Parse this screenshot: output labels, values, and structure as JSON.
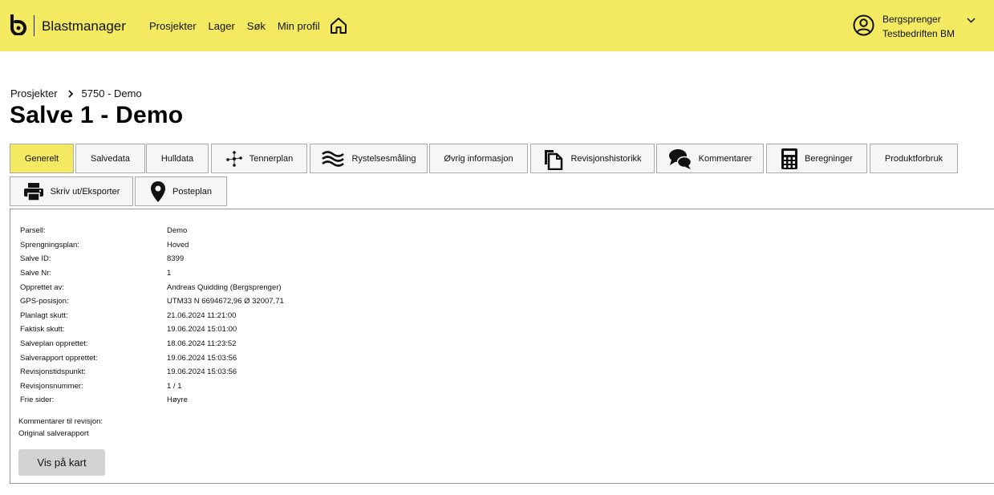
{
  "header": {
    "brand": "Blastmanager",
    "nav": [
      "Prosjekter",
      "Lager",
      "Søk",
      "Min profil"
    ],
    "user_name": "Bergsprenger",
    "user_company": "Testbedriften BM",
    "colors": {
      "topbar": "#f4ea62",
      "active_tab": "#f4ea62"
    }
  },
  "breadcrumb": {
    "root": "Prosjekter",
    "current": "5750 - Demo"
  },
  "page": {
    "title": "Salve 1 - Demo"
  },
  "tabs": [
    {
      "label": "Generelt",
      "icon": "",
      "active": true
    },
    {
      "label": "Salvedata",
      "icon": ""
    },
    {
      "label": "Hulldata",
      "icon": ""
    },
    {
      "label": "Tennerplan",
      "icon": "network-icon"
    },
    {
      "label": "Rystelsesmåling",
      "icon": "waves-icon"
    },
    {
      "label": "Øvrig informasjon",
      "icon": ""
    },
    {
      "label": "Revisjonshistorikk",
      "icon": "copy-icon"
    },
    {
      "label": "Kommentarer",
      "icon": "chat-icon"
    },
    {
      "label": "Beregninger",
      "icon": "calculator-icon"
    },
    {
      "label": "Produktforbruk",
      "icon": ""
    },
    {
      "label": "Skriv ut/Eksporter",
      "icon": "printer-icon"
    },
    {
      "label": "Posteplan",
      "icon": "map-pin-icon"
    }
  ],
  "info": [
    {
      "label": "Parsell:",
      "value": "Demo"
    },
    {
      "label": "Sprengningsplan:",
      "value": "Hoved"
    },
    {
      "label": "Salve ID:",
      "value": "8399"
    },
    {
      "label": "Salve Nr:",
      "value": "1"
    },
    {
      "label": "Opprettet av:",
      "value": "Andreas Quidding (Bergsprenger)"
    },
    {
      "label": "GPS-posisjon:",
      "value": "UTM33 N 6694672,96 Ø 32007,71"
    },
    {
      "label": "Planlagt skutt:",
      "value": "21.06.2024 11:21:00"
    },
    {
      "label": "Faktisk skutt:",
      "value": "19.06.2024 15:01:00"
    },
    {
      "label": "Salveplan opprettet:",
      "value": "18.06.2024 11:23:52"
    },
    {
      "label": "Salverapport opprettet:",
      "value": "19.06.2024 15:03:56"
    },
    {
      "label": "Revisjonstidspunkt:",
      "value": "19.06.2024 15:03:56"
    },
    {
      "label": "Revisjonsnummer:",
      "value": "1 / 1"
    },
    {
      "label": "Frie sider:",
      "value": "Høyre"
    }
  ],
  "comment": {
    "label": "Kommentarer til revisjon:",
    "text": "Original salverapport"
  },
  "map_button": "Vis på kart"
}
